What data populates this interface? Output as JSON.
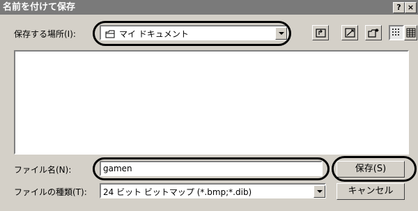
{
  "window": {
    "title": "名前を付けて保存",
    "help_label": "?",
    "close_label": "×"
  },
  "location": {
    "label": "保存する場所(I):",
    "value": "マイ ドキュメント"
  },
  "filename": {
    "label": "ファイル名(N):",
    "value": "gamen"
  },
  "filetype": {
    "label": "ファイルの種類(T):",
    "value": "24 ビット ビットマップ (*.bmp;*.dib)"
  },
  "buttons": {
    "save_label": "保存(S)",
    "cancel_label": "キャンセル"
  },
  "icons": {
    "up_folder": "up-folder-icon",
    "desktop": "desktop-icon",
    "new_folder": "new-folder-icon",
    "list_view": "list-view-icon",
    "details_view": "details-view-icon"
  }
}
